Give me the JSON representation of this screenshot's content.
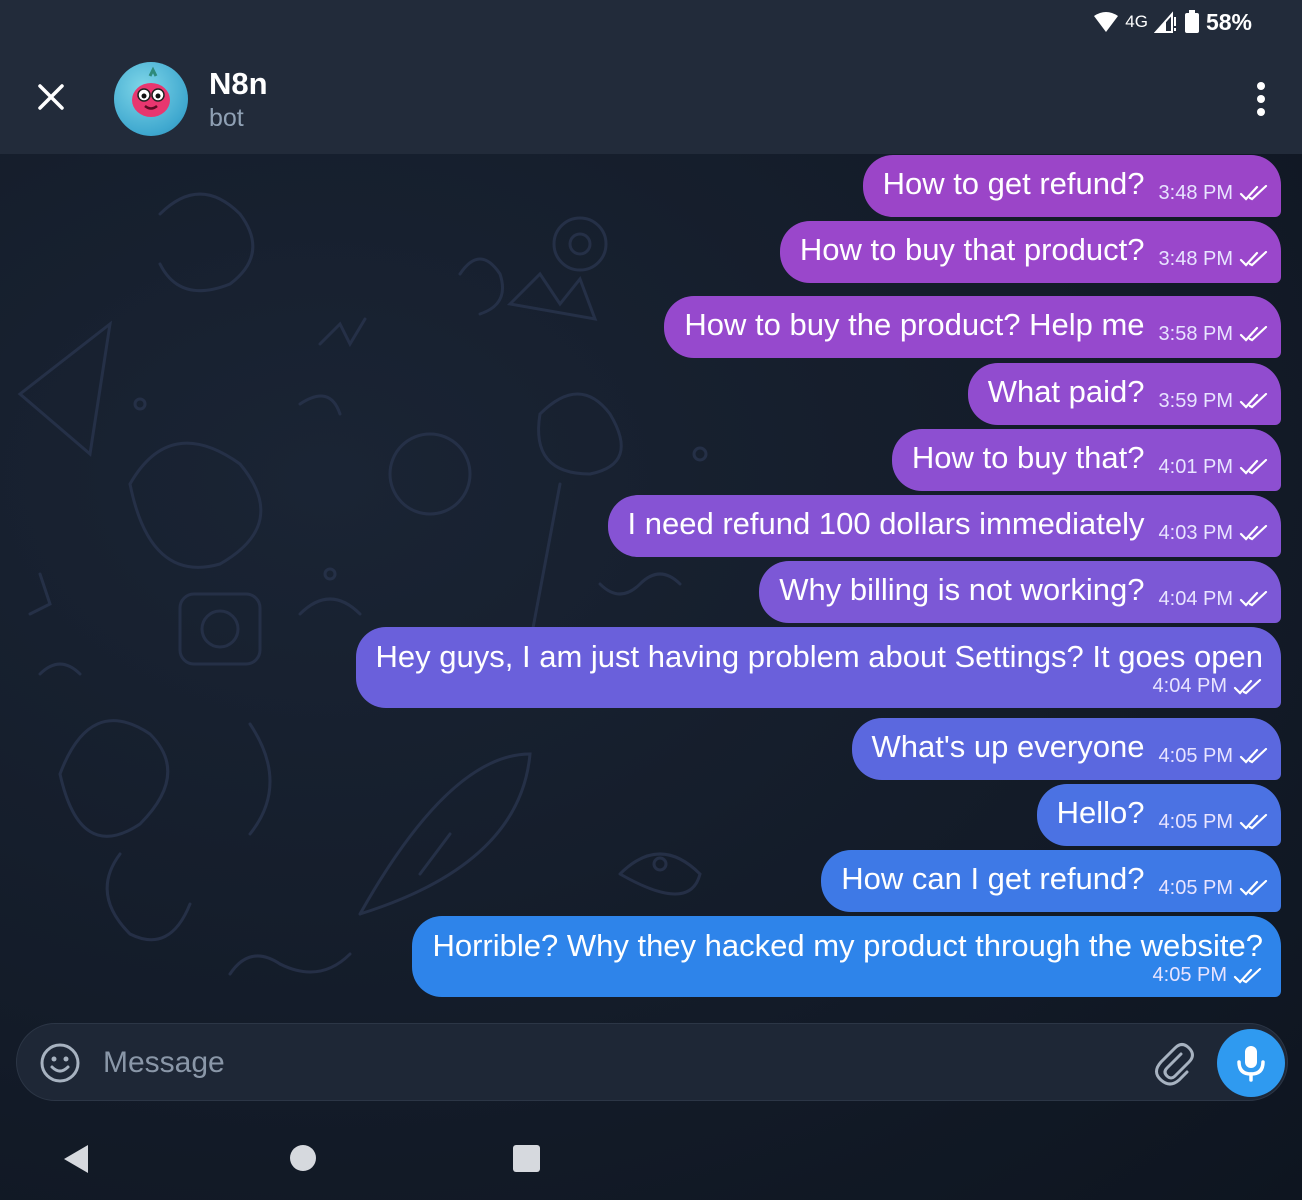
{
  "status_bar": {
    "network": "4G",
    "battery": "58%"
  },
  "header": {
    "title": "N8n",
    "subtitle": "bot"
  },
  "messages": [
    {
      "text": "How to get refund?",
      "time": "3:48 PM",
      "color": "#9b45c8"
    },
    {
      "text": "How to buy that product?",
      "time": "3:48 PM",
      "color": "#9a47cb"
    },
    {
      "text": "How to buy the product? Help me",
      "time": "3:58 PM",
      "color": "#9649cd"
    },
    {
      "text": "What paid?",
      "time": "3:59 PM",
      "color": "#914ccf"
    },
    {
      "text": "How to buy that?",
      "time": "4:01 PM",
      "color": "#8d4fd1"
    },
    {
      "text": "I need refund 100 dollars immediately",
      "time": "4:03 PM",
      "color": "#8653d4"
    },
    {
      "text": "Why billing is not working?",
      "time": "4:04 PM",
      "color": "#7c58d6"
    },
    {
      "text": "Hey guys, I am just having problem about Settings? It goes open",
      "time": "4:04 PM",
      "color": "#6a60db"
    },
    {
      "text": "What's up everyone",
      "time": "4:05 PM",
      "color": "#5b68df"
    },
    {
      "text": "Hello?",
      "time": "4:05 PM",
      "color": "#4b72e3"
    },
    {
      "text": "How can I get refund?",
      "time": "4:05 PM",
      "color": "#3e79e6"
    },
    {
      "text": "Horrible? Why they hacked my product through the website?",
      "time": "4:05 PM",
      "color": "#2e84ea"
    }
  ],
  "composer": {
    "placeholder": "Message"
  },
  "colors": {
    "mic_button": "#2f9af0",
    "header_bg": "#222b3a"
  }
}
